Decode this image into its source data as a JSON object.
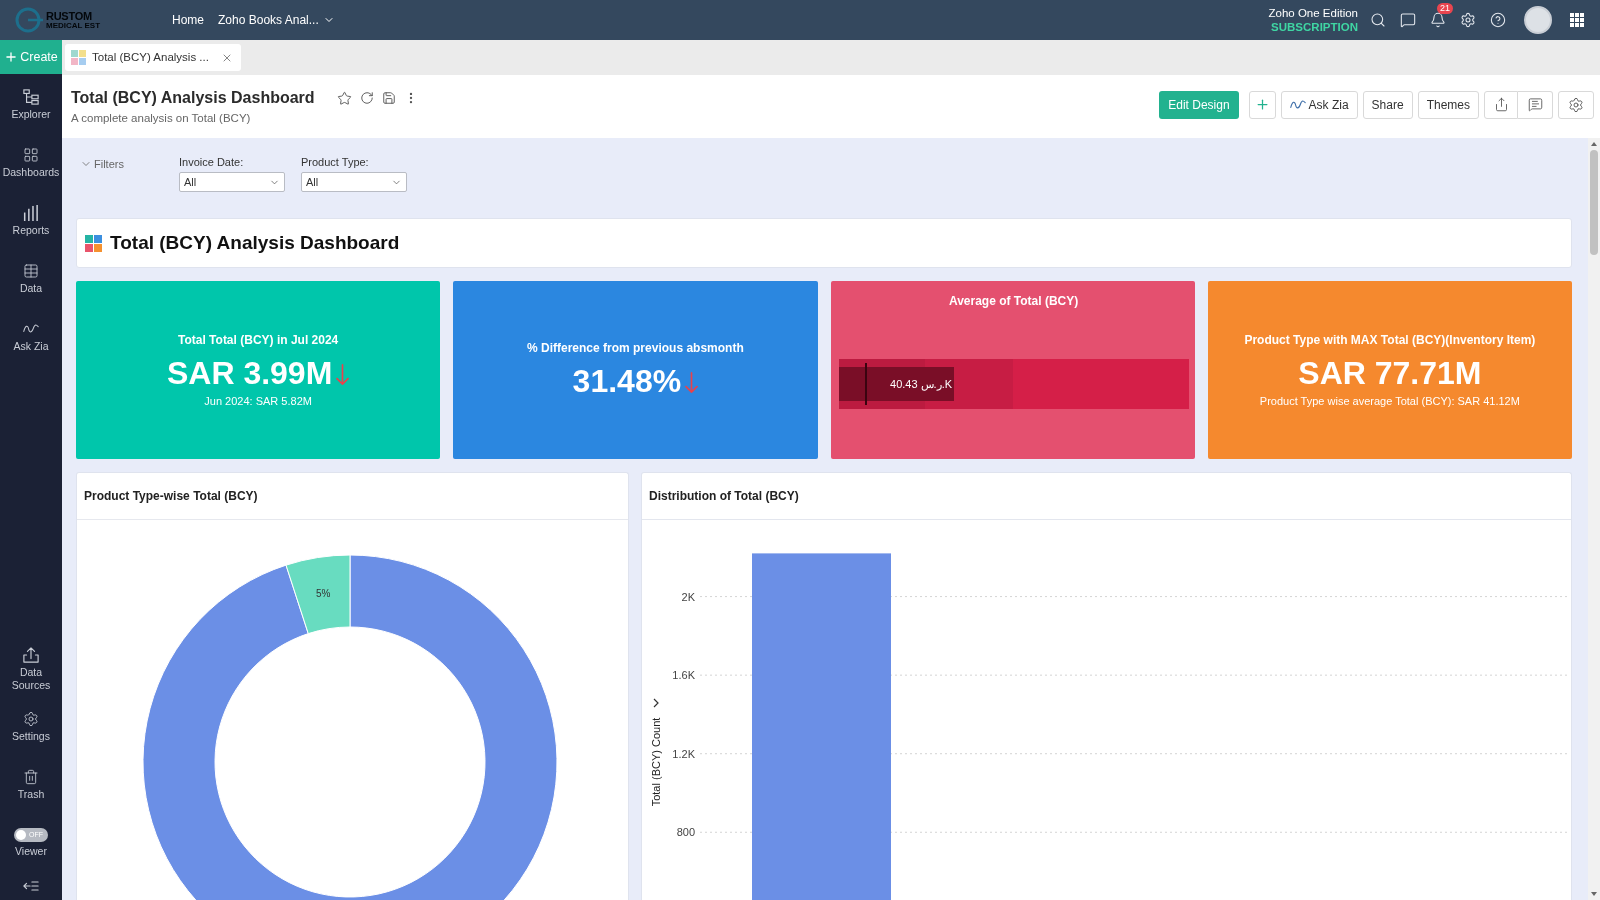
{
  "top_bar": {
    "logo": {
      "name": "RUSTOM",
      "tagline": "MEDICAL EST"
    },
    "nav": [
      {
        "label": "Home",
        "dropdown": false
      },
      {
        "label": "Zoho Books Anal...",
        "dropdown": true
      }
    ],
    "edition": {
      "name": "Zoho One Edition",
      "plan": "SUBSCRIPTION"
    },
    "notifications": {
      "count": "21"
    }
  },
  "sidebar": {
    "create": "Create",
    "items": [
      {
        "label": "Explorer"
      },
      {
        "label": "Dashboards"
      },
      {
        "label": "Reports"
      },
      {
        "label": "Data"
      },
      {
        "label": "Ask Zia"
      }
    ],
    "bottom_items": [
      {
        "label": "Data Sources"
      },
      {
        "label": "Settings"
      },
      {
        "label": "Trash"
      }
    ],
    "viewer": {
      "label": "Viewer",
      "switch_text": "OFF",
      "on": false
    }
  },
  "tabs": [
    {
      "label": "Total (BCY) Analysis ...",
      "selected": true
    }
  ],
  "header": {
    "title": "Total (BCY) Analysis Dashboard",
    "subtitle": "A complete analysis on Total (BCY)",
    "actions": [
      {
        "kind": "primary",
        "label": "Edit Design"
      },
      {
        "kind": "zia",
        "label": "Ask Zia"
      },
      {
        "kind": "plain",
        "label": "Share"
      },
      {
        "kind": "plain",
        "label": "Themes"
      }
    ]
  },
  "filters": {
    "label": "Filters",
    "expanded": true,
    "fields": [
      {
        "label": "Invoice Date:",
        "value": "All"
      },
      {
        "label": "Product Type:",
        "value": "All"
      }
    ]
  },
  "dashboard": {
    "title": "Total (BCY) Analysis Dashboard",
    "cards": [
      {
        "kind": "kpi",
        "color": "#00c6ab",
        "title": "Total Total (BCY) in Jul 2024",
        "value": "SAR 3.99M",
        "trend_down": true,
        "footnote": "Jun 2024: SAR 5.82M"
      },
      {
        "kind": "kpi",
        "color": "#2b87e0",
        "title": "% Difference from previous absmonth",
        "value": "31.48%",
        "trend_down": true
      },
      {
        "kind": "bullet",
        "color": "#e4506f",
        "title": "Average of Total (BCY)",
        "reading": "40.43 ر.س.K",
        "level": 0.33
      },
      {
        "kind": "kpi",
        "color": "#f5892e",
        "title": "Product Type with MAX Total (BCY)(Inventory Item)",
        "value": "SAR 77.71M",
        "footnote": "Product Type wise average Total (BCY): SAR 41.12M"
      }
    ],
    "charts": [
      {
        "title": "Product Type-wise Total (BCY)",
        "chart_data": {
          "type": "donut",
          "values": [
            95,
            5
          ],
          "value_labels": [
            null,
            "5%"
          ]
        }
      },
      {
        "title": "Distribution of Total (BCY)",
        "chart_data": {
          "type": "bar",
          "ylabel": "Total (BCY) Count",
          "values": [
            2220
          ],
          "ylim": [
            450,
            2390
          ],
          "grid": true,
          "yticks": [
            {
              "value": 800,
              "label": "800"
            },
            {
              "value": 1200,
              "label": "1.2K"
            },
            {
              "value": 1600,
              "label": "1.6K"
            },
            {
              "value": 2000,
              "label": "2K"
            }
          ]
        }
      }
    ]
  }
}
